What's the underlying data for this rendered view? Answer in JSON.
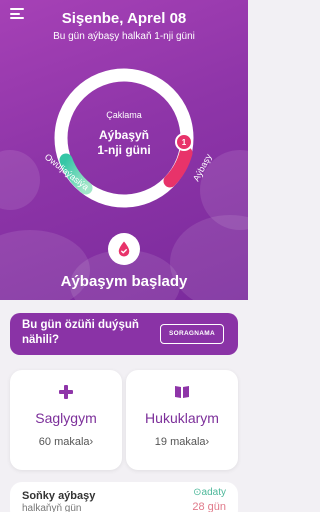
{
  "header": {
    "date": "Sişenbe, Aprel 08",
    "subtitle": "Bu gün aýbaşy halkaň 1-nji güni"
  },
  "ring": {
    "phase_label": "Çaklama",
    "center_title_line1": "Aýbaşyň",
    "center_title_line2": "1-nji güni",
    "marker_value": "1",
    "label_right": "Aýbaşy",
    "label_left": "Owuljaýasiýa",
    "colors": {
      "period": "#e8336a",
      "ovulation": "#35c6a6",
      "track": "#ffffff"
    }
  },
  "status": "Aýbaşym başlady",
  "question": {
    "text": "Bu gün özüňi duýşuň nähili?",
    "button": "SORAGNAMA"
  },
  "cards": [
    {
      "title": "Saglygym",
      "count": "60 makala",
      "chevron": "›",
      "icon": "plus-icon"
    },
    {
      "title": "Hukuklarym",
      "count": "19 makala",
      "chevron": "›",
      "icon": "book-icon"
    }
  ],
  "bottom": {
    "title": "Soňky aýbaşy",
    "subtitle": "halkaňyň gün",
    "tag": "adaty",
    "days": "28 gün"
  },
  "colors": {
    "primary": "#8e35a8",
    "accent": "#e8336a",
    "ovulation": "#35c6a6"
  }
}
